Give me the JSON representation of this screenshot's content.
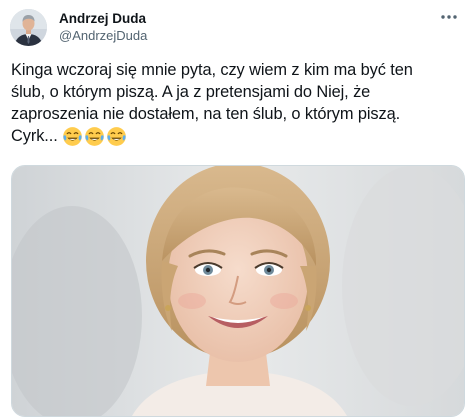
{
  "author": {
    "name": "Andrzej Duda",
    "handle": "@AndrzejDuda"
  },
  "more_icon": "more-horizontal-icon",
  "tweet": {
    "lines": [
      "Kinga wczoraj się mnie pyta, czy wiem z kim ma być ten",
      "ślub, o którym piszą. A ja z pretensjami do Niej, że",
      "zaproszenia nie dostałem, na ten ślub, o którym piszą.",
      "Cyrk..."
    ],
    "emojis": [
      "tears-of-joy-emoji",
      "tears-of-joy-emoji",
      "tears-of-joy-emoji"
    ]
  },
  "colors": {
    "text": "#0f1419",
    "secondary": "#536471",
    "border": "#cfd9de"
  }
}
